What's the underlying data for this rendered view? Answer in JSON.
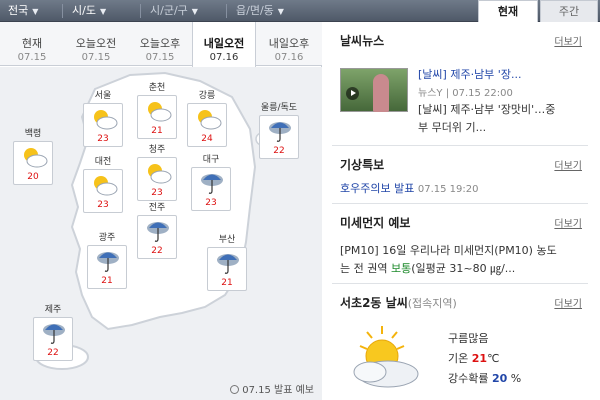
{
  "topbar": {
    "locations": [
      {
        "label": "전국",
        "dim": false
      },
      {
        "label": "시/도",
        "dim": false
      },
      {
        "label": "시/군/구",
        "dim": true
      },
      {
        "label": "읍/면/동",
        "dim": true
      }
    ],
    "toggles": [
      {
        "label": "현재",
        "active": true
      },
      {
        "label": "주간",
        "active": false
      }
    ]
  },
  "time_tabs": [
    {
      "label": "현재",
      "date": "07.15",
      "active": false
    },
    {
      "label": "오늘오전",
      "date": "07.15",
      "active": false
    },
    {
      "label": "오늘오후",
      "date": "07.15",
      "active": false
    },
    {
      "label": "내일오전",
      "date": "07.16",
      "active": true
    },
    {
      "label": "내일오후",
      "date": "07.16",
      "active": false
    }
  ],
  "cities": [
    {
      "name": "백령",
      "temp": "20",
      "icon": "partly-cloudy-icon"
    },
    {
      "name": "서울",
      "temp": "23",
      "icon": "partly-cloudy-icon"
    },
    {
      "name": "춘천",
      "temp": "21",
      "icon": "partly-cloudy-icon"
    },
    {
      "name": "강릉",
      "temp": "24",
      "icon": "partly-cloudy-icon"
    },
    {
      "name": "울릉/독도",
      "temp": "22",
      "icon": "rain-icon"
    },
    {
      "name": "대전",
      "temp": "23",
      "icon": "partly-cloudy-icon"
    },
    {
      "name": "청주",
      "temp": "23",
      "icon": "partly-cloudy-icon"
    },
    {
      "name": "대구",
      "temp": "23",
      "icon": "rain-icon"
    },
    {
      "name": "전주",
      "temp": "22",
      "icon": "rain-icon"
    },
    {
      "name": "광주",
      "temp": "21",
      "icon": "rain-icon"
    },
    {
      "name": "부산",
      "temp": "21",
      "icon": "rain-icon"
    },
    {
      "name": "제주",
      "temp": "22",
      "icon": "rain-icon"
    }
  ],
  "map_footnote": "07.15 발표 예보",
  "news": {
    "title": "날씨뉴스",
    "more": "더보기",
    "thumb_caption": "",
    "headline_tag": "[날씨]",
    "headline": "제주·남부 '장...",
    "source": "뉴스Y",
    "time": "07.15 22:00",
    "line2": "[날씨] 제주·남부 '장맛비'…중",
    "line3": "부 무더위 기..."
  },
  "special": {
    "title": "기상특보",
    "more": "더보기",
    "text": "호우주의보 발표",
    "time": "07.15 19:20"
  },
  "dust": {
    "title": "미세먼지 예보",
    "more": "더보기",
    "line1": "[PM10] 16일 우리나라 미세먼지(PM10) 농도",
    "line2_a": "는 전 권역 ",
    "line2_level": "보통",
    "line2_b": "(일평균 31~80 ㎍/..."
  },
  "local": {
    "title": "서초2동 날씨",
    "sub": "(접속지역)",
    "more": "더보기",
    "condition": "구름많음",
    "temp_label": "기온",
    "temp": "21",
    "temp_unit": "℃",
    "rain_label": "강수확률",
    "rain": "20",
    "rain_unit": "%"
  },
  "colors": {
    "temp": "#dd1111",
    "link": "#2146a8",
    "level_ok": "#1d8a2b"
  }
}
